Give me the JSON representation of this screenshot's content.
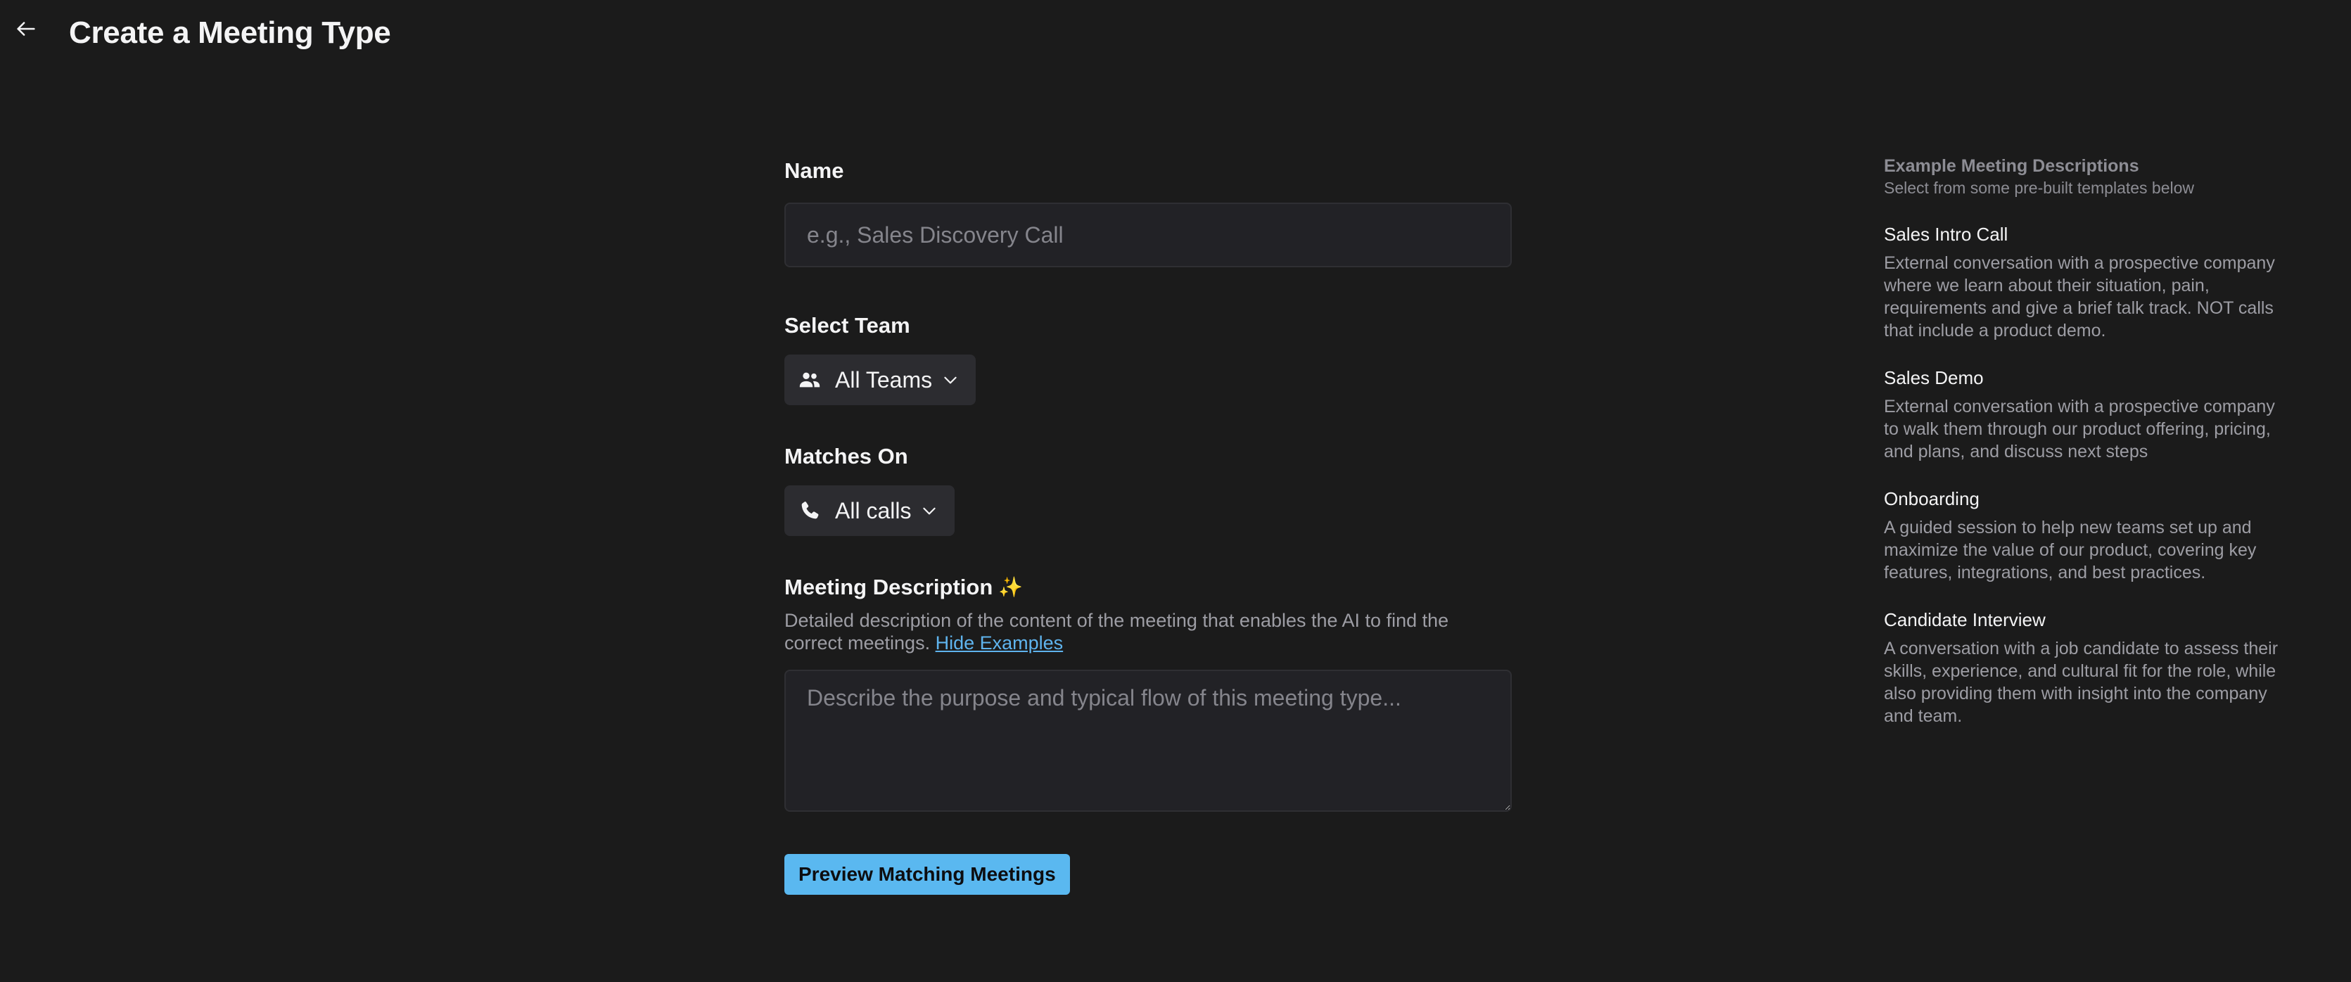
{
  "header": {
    "title": "Create a Meeting Type",
    "back_icon": "arrow-left-icon"
  },
  "form": {
    "name": {
      "label": "Name",
      "placeholder": "e.g., Sales Discovery Call",
      "value": ""
    },
    "team": {
      "label": "Select Team",
      "icon": "users-icon",
      "selected": "All Teams"
    },
    "matches_on": {
      "label": "Matches On",
      "icon": "phone-icon",
      "selected": "All calls"
    },
    "description": {
      "label": "Meeting Description",
      "sparkle": "✨",
      "helper": "Detailed description of the content of the meeting that enables the AI to find the correct meetings.",
      "hide_link": "Hide Examples",
      "placeholder": "Describe the purpose and typical flow of this meeting type...",
      "value": ""
    },
    "preview_button": "Preview Matching Meetings"
  },
  "sidebar": {
    "title": "Example Meeting Descriptions",
    "subtitle": "Select from some pre-built templates below",
    "templates": [
      {
        "name": "Sales Intro Call",
        "description": "External conversation with a prospective company where we learn about their situation, pain, requirements and give a brief talk track. NOT calls that include a product demo."
      },
      {
        "name": "Sales Demo",
        "description": "External conversation with a prospective company to walk them through our product offering, pricing, and plans, and discuss next steps"
      },
      {
        "name": "Onboarding",
        "description": "A guided session to help new teams set up and maximize the value of our product, covering key features, integrations, and best practices."
      },
      {
        "name": "Candidate Interview",
        "description": "A conversation with a job candidate to assess their skills, experience, and cultural fit for the role, while also providing them with insight into the company and team."
      }
    ]
  },
  "colors": {
    "background": "#1b1b1b",
    "input_bg": "#222226",
    "select_bg": "#2c2c30",
    "accent": "#5ab8f0",
    "link": "#5fb4ee"
  }
}
